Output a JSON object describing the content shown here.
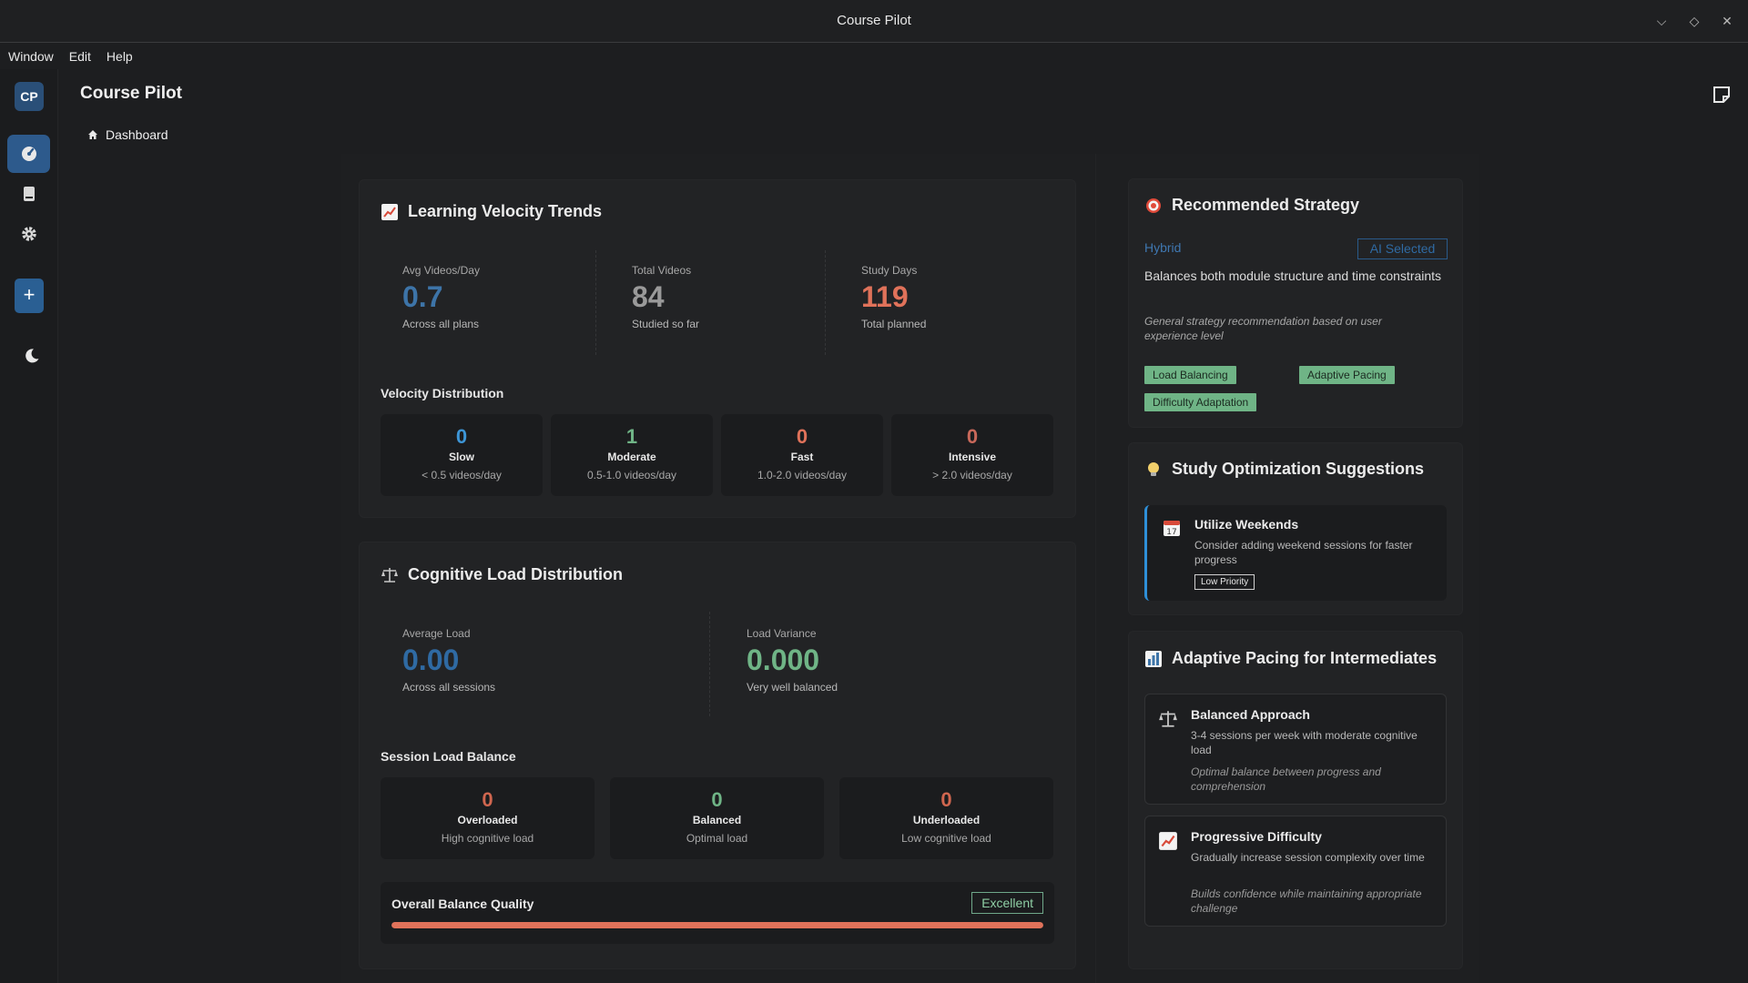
{
  "window": {
    "title": "Course Pilot"
  },
  "menu": [
    "Window",
    "Edit",
    "Help"
  ],
  "rail": {
    "logo": "CP",
    "add": "+"
  },
  "header": {
    "title": "Course Pilot",
    "breadcrumb": "Dashboard"
  },
  "velocity": {
    "title": "Learning Velocity Trends",
    "stats": [
      {
        "label": "Avg Videos/Day",
        "value": "0.7",
        "sub": "Across all plans",
        "color": "#3d74a8"
      },
      {
        "label": "Total Videos",
        "value": "84",
        "sub": "Studied so far",
        "color": "#9a9a9a"
      },
      {
        "label": "Study Days",
        "value": "119",
        "sub": "Total planned",
        "color": "#e0725a"
      }
    ],
    "dist_title": "Velocity Distribution",
    "dist": [
      {
        "value": "0",
        "label": "Slow",
        "range": "< 0.5 videos/day",
        "color": "#3d95d6"
      },
      {
        "value": "1",
        "label": "Moderate",
        "range": "0.5-1.0 videos/day",
        "color": "#6fb486"
      },
      {
        "value": "0",
        "label": "Fast",
        "range": "1.0-2.0 videos/day",
        "color": "#e0725a"
      },
      {
        "value": "0",
        "label": "Intensive",
        "range": "> 2.0 videos/day",
        "color": "#c8685a"
      }
    ]
  },
  "cognitive": {
    "title": "Cognitive Load Distribution",
    "stats": [
      {
        "label": "Average Load",
        "value": "0.00",
        "sub": "Across all sessions",
        "color": "#2f6aa3"
      },
      {
        "label": "Load Variance",
        "value": "0.000",
        "sub": "Very well balanced",
        "color": "#6fb486"
      }
    ],
    "balance_title": "Session Load Balance",
    "balance": [
      {
        "value": "0",
        "label": "Overloaded",
        "desc": "High cognitive load",
        "color": "#d0664f"
      },
      {
        "value": "0",
        "label": "Balanced",
        "desc": "Optimal load",
        "color": "#6fb486"
      },
      {
        "value": "0",
        "label": "Underloaded",
        "desc": "Low cognitive load",
        "color": "#d0664f"
      }
    ],
    "quality_label": "Overall Balance Quality",
    "quality_badge": "Excellent",
    "quality_fraction": 1.0
  },
  "strategy": {
    "title": "Recommended Strategy",
    "name": "Hybrid",
    "badge": "AI Selected",
    "desc": "Balances both module structure and time constraints",
    "note": "General strategy recommendation based on user experience level",
    "tags": [
      "Load Balancing",
      "Adaptive Pacing",
      "Difficulty Adaptation"
    ]
  },
  "suggestions": {
    "title": "Study Optimization Suggestions",
    "items": [
      {
        "title": "Utilize Weekends",
        "desc": "Consider adding weekend sessions for faster progress",
        "priority": "Low Priority"
      }
    ]
  },
  "pacing": {
    "title": "Adaptive Pacing for Intermediates",
    "items": [
      {
        "title": "Balanced Approach",
        "desc": "3-4 sessions per week with moderate cognitive load",
        "note": "Optimal balance between progress and comprehension"
      },
      {
        "title": "Progressive Difficulty",
        "desc": "Gradually increase session complexity over time",
        "note": "Builds confidence while maintaining appropriate challenge"
      }
    ]
  }
}
